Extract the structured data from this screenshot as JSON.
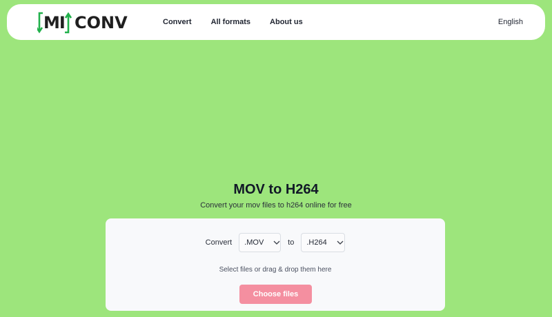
{
  "header": {
    "logo_left": "MI",
    "logo_right": "CONV",
    "nav": [
      {
        "label": "Convert"
      },
      {
        "label": "All formats"
      },
      {
        "label": "About us"
      }
    ],
    "language": "English"
  },
  "hero": {
    "title": "MOV to H264",
    "subtitle": "Convert your mov files to h264 online for free"
  },
  "converter": {
    "convert_label": "Convert",
    "from_format": ".MOV",
    "to_label": "to",
    "to_format": ".H264",
    "hint": "Select files or drag & drop them here",
    "choose_button": "Choose files"
  },
  "colors": {
    "background": "#9de57c",
    "logo_accent": "#22b14c",
    "button": "#f48fa0"
  }
}
